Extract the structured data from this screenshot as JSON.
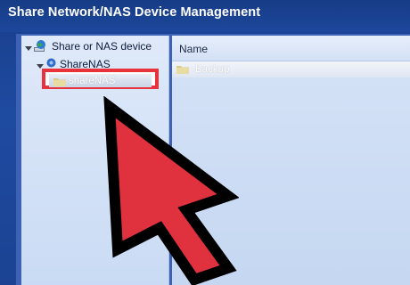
{
  "window": {
    "title": "Share Network/NAS Device Management"
  },
  "tree": {
    "root": {
      "label": "Share or NAS device",
      "icon": "network-globe-icon",
      "expanded": true
    },
    "child": {
      "label": "ShareNAS",
      "icon": "network-node-icon",
      "expanded": true
    },
    "selected_share": {
      "label": "shareNAS",
      "icon": "folder-icon",
      "highlight_color": "#e8323c"
    }
  },
  "list": {
    "column_header": "Name",
    "rows": [
      {
        "label": "Backup",
        "icon": "folder-icon"
      }
    ]
  },
  "overlay": {
    "icon": "red-arrow-pointer-icon",
    "color": "#e0323e"
  }
}
